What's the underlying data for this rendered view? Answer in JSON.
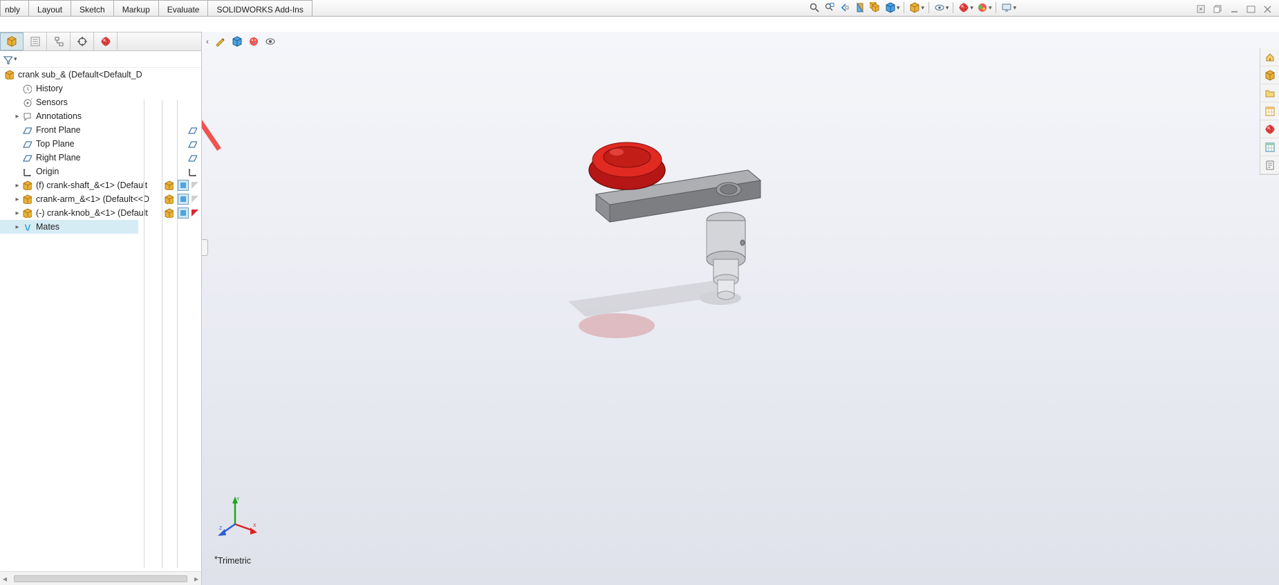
{
  "cmdTabs": {
    "partial": "nbly",
    "layout": "Layout",
    "sketch": "Sketch",
    "markup": "Markup",
    "evaluate": "Evaluate",
    "addins": "SOLIDWORKS Add-Ins"
  },
  "tree": {
    "root": "crank sub_&  (Default<Default_D",
    "history": "History",
    "sensors": "Sensors",
    "annotations": "Annotations",
    "front": "Front Plane",
    "top": "Top Plane",
    "right": "Right Plane",
    "origin": "Origin",
    "p1": "(f) crank-shaft_&<1> (Default",
    "p2": "crank-arm_&<1> (Default<<D",
    "p3": "(-) crank-knob_&<1> (Default",
    "mates": "Mates"
  },
  "viewLabel": "Trimetric",
  "hudIcons": {
    "zoomfit": "zoom-to-fit-icon",
    "zoomarea": "zoom-area-icon",
    "prev": "previous-view-icon",
    "section": "section-view-icon",
    "orient": "view-orientation-icon",
    "display": "display-style-icon",
    "hide": "hide-show-icon",
    "appearance": "edit-appearance-icon",
    "scene": "apply-scene-icon",
    "settings": "view-settings-icon"
  },
  "sidebarIcons": {
    "home": "home-icon",
    "model": "model-icon",
    "open": "open-folder-icon",
    "table": "table-icon",
    "appearance": "appearance-icon",
    "props": "custom-props-icon",
    "configs": "configs-icon"
  }
}
